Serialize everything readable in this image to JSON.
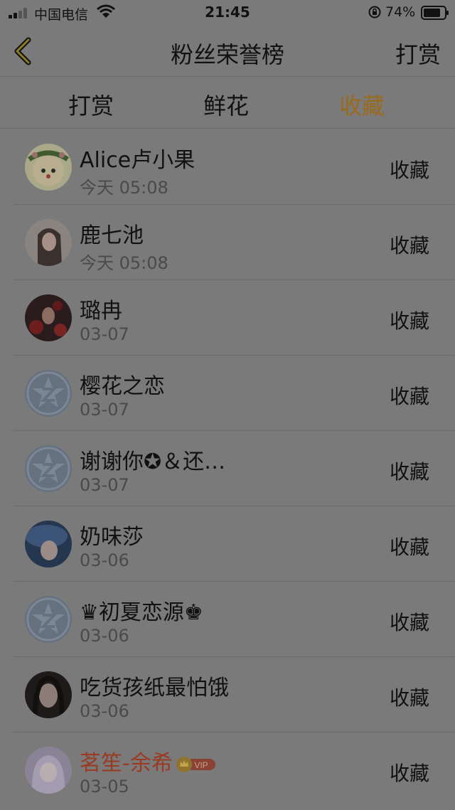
{
  "status_bar": {
    "carrier": "中国电信",
    "time": "21:45",
    "battery_percent": "74%"
  },
  "nav": {
    "title": "粉丝荣誉榜",
    "right_action": "打赏"
  },
  "tabs": [
    {
      "label": "打赏",
      "active": false
    },
    {
      "label": "鲜花",
      "active": false
    },
    {
      "label": "收藏",
      "active": true
    }
  ],
  "colors": {
    "active_tab": "#9a6a1c",
    "vip_name": "#9a3a22"
  },
  "fans": [
    {
      "name": "Alice卢小果",
      "date": "今天 05:08",
      "type": "收藏",
      "avatar": "flower-crown-avatar"
    },
    {
      "name": "鹿七池",
      "date": "今天 05:08",
      "type": "收藏",
      "avatar": "girl-photo-avatar"
    },
    {
      "name": "璐冉",
      "date": "03-07",
      "type": "收藏",
      "avatar": "red-flowers-avatar"
    },
    {
      "name": "樱花之恋",
      "date": "03-07",
      "type": "收藏",
      "avatar": "default-star-avatar"
    },
    {
      "name": "谢谢你✪＆还…",
      "date": "03-07",
      "type": "收藏",
      "avatar": "default-star-avatar"
    },
    {
      "name": "奶味莎",
      "date": "03-06",
      "type": "收藏",
      "avatar": "blue-hat-avatar"
    },
    {
      "name": "♛初夏恋源♚",
      "date": "03-06",
      "type": "收藏",
      "avatar": "default-star-avatar"
    },
    {
      "name": "吃货孩纸最怕饿",
      "date": "03-06",
      "type": "收藏",
      "avatar": "dark-hair-avatar"
    },
    {
      "name": "茗笙-余希",
      "date": "03-05",
      "type": "收藏",
      "avatar": "anime-girl-avatar",
      "vip": true,
      "vip_label": "VIP"
    }
  ]
}
